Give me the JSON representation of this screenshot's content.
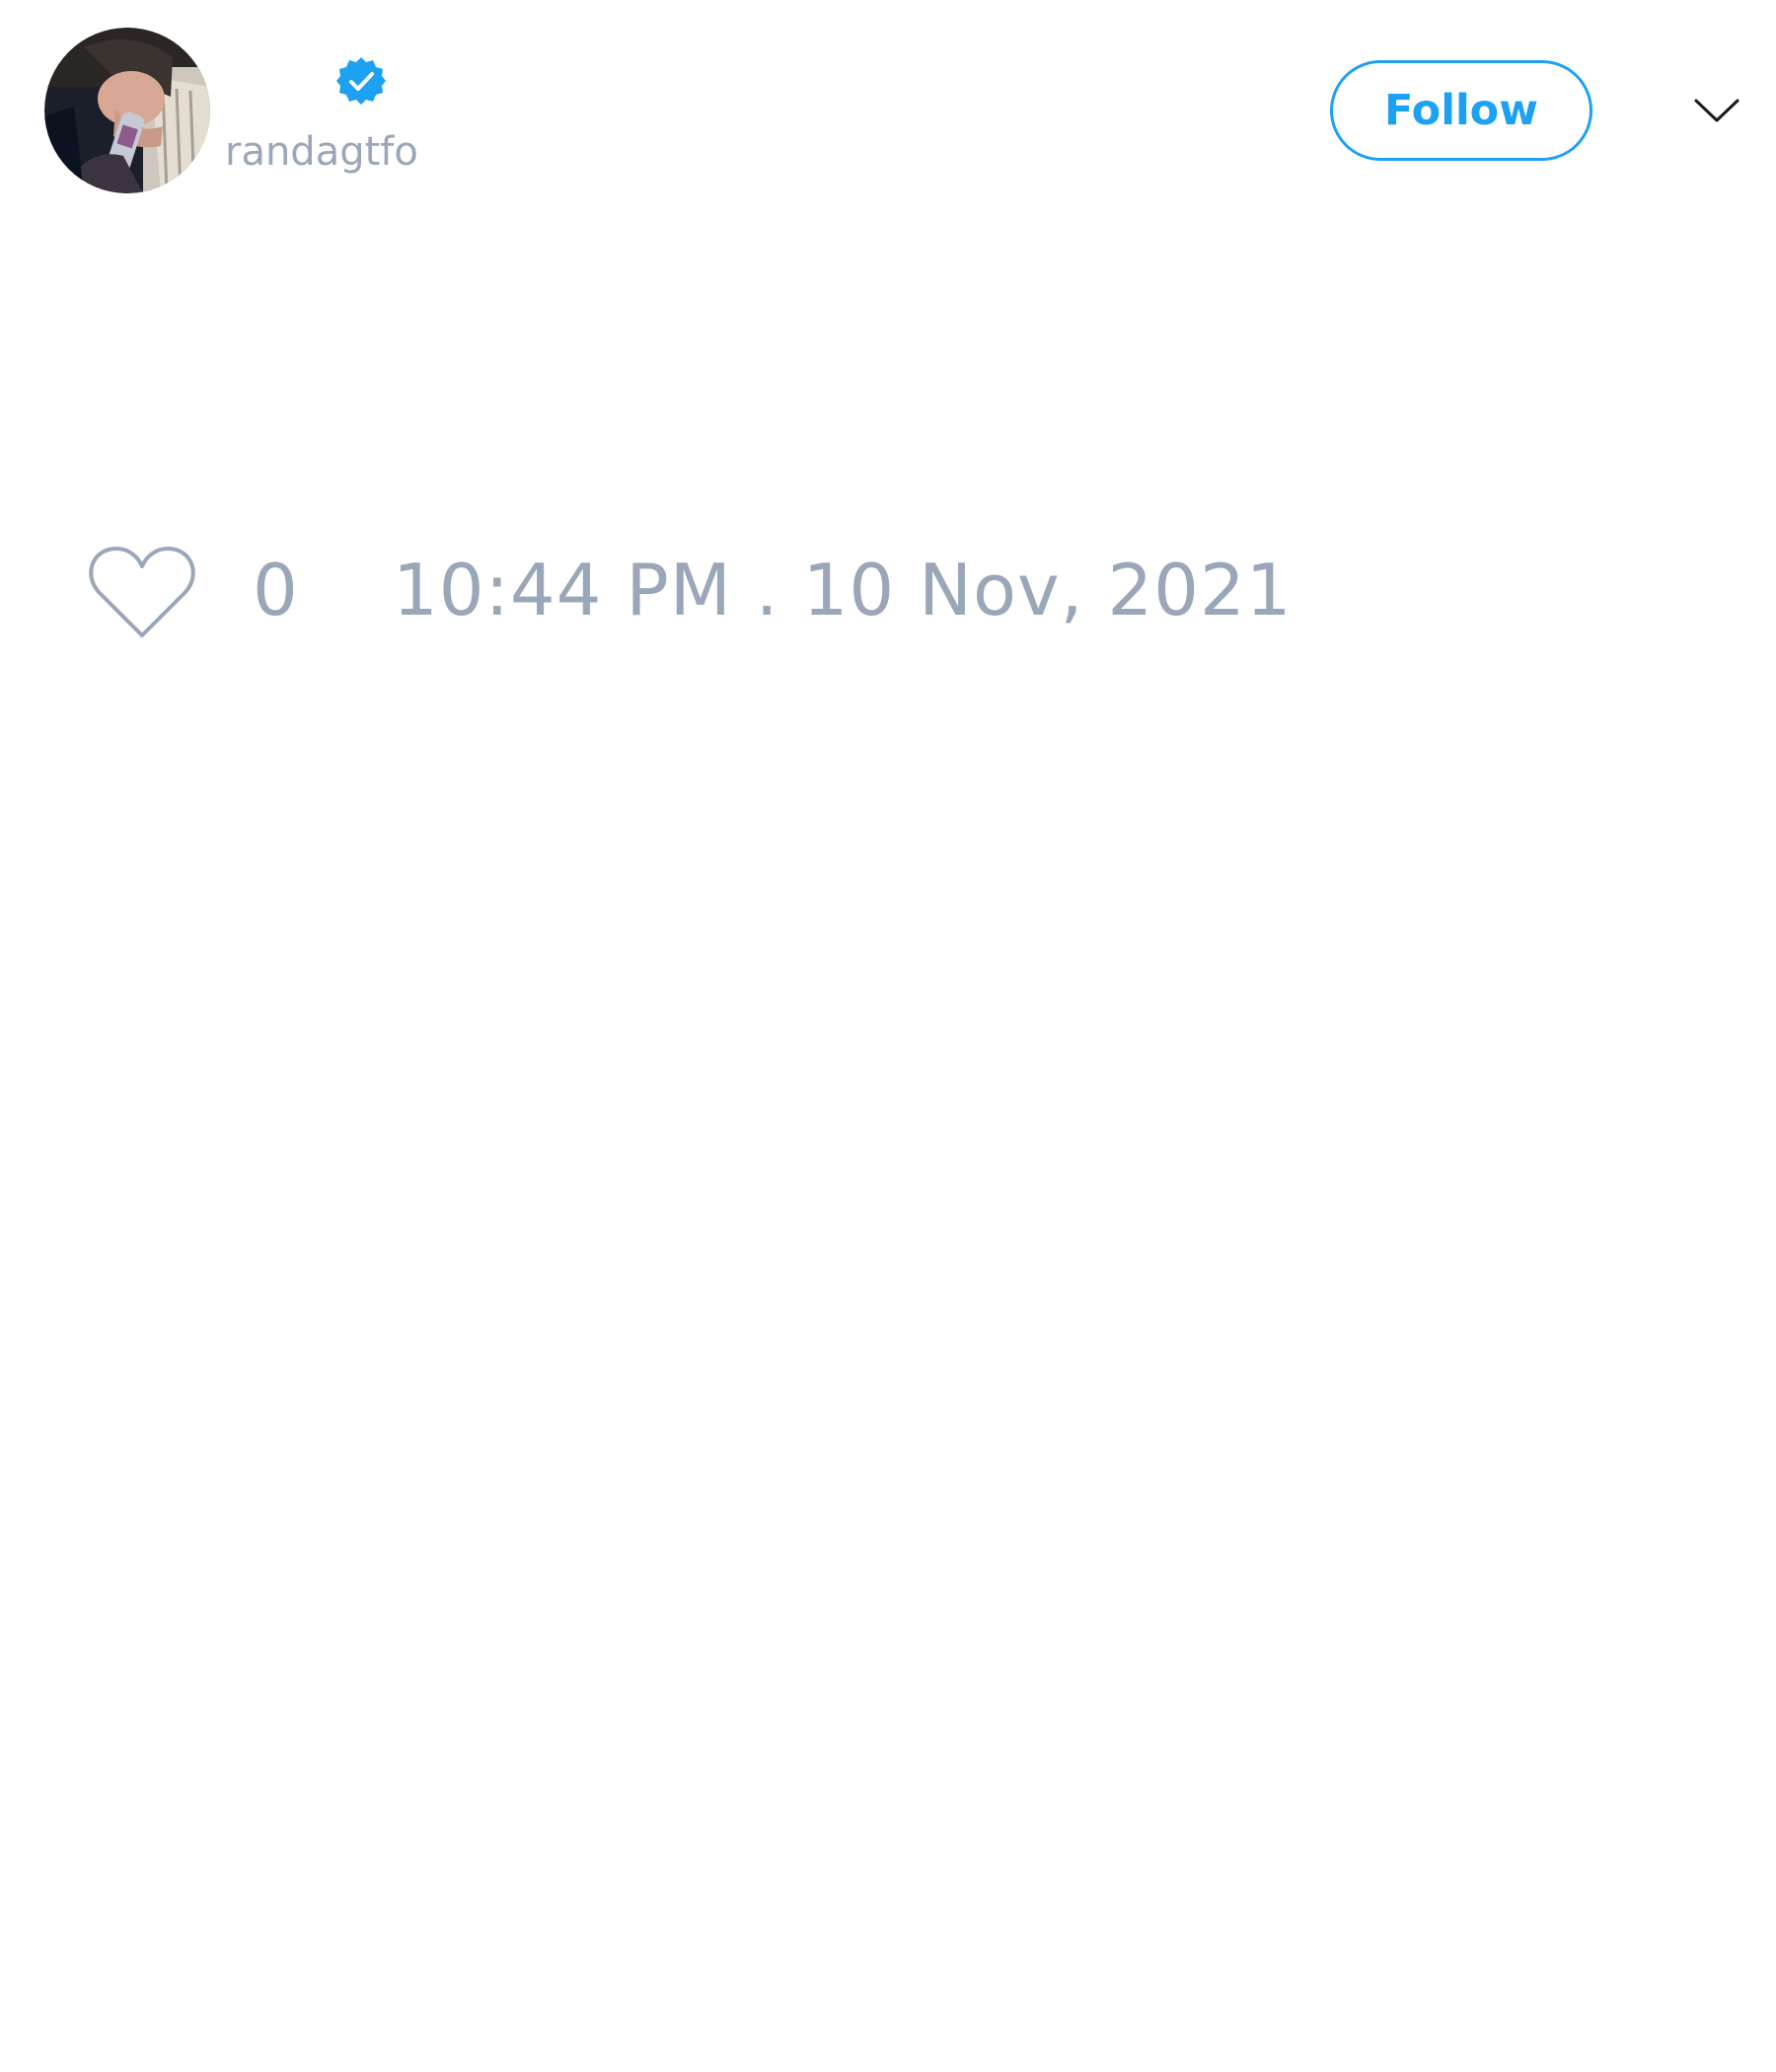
{
  "user": {
    "display_name": "",
    "handle": "randagtfo",
    "verified": true,
    "avatar_icon": "profile-photo"
  },
  "header": {
    "follow_label": "Follow",
    "menu_icon": "chevron-down-icon"
  },
  "actions": {
    "like_icon": "heart-outline-icon",
    "like_count": "0",
    "timestamp": "10:44 PM . 10 Nov, 2021"
  },
  "colors": {
    "accent": "#1da1f2",
    "muted_text": "#9aa7b8",
    "background": "#ffffff"
  }
}
